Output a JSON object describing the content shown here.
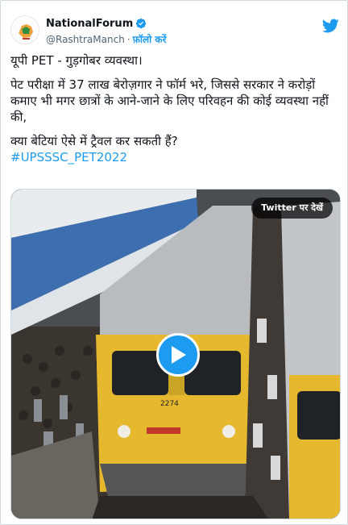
{
  "author": {
    "display_name": "NationalForum",
    "handle": "@RashtraManch",
    "separator": "·",
    "follow_label": "फ़ॉलो करें",
    "verified": true
  },
  "tweet": {
    "line1": "यूपी PET - गुड़गोबर व्यवस्था।",
    "line2": "पेट परीक्षा में 37 लाख बेरोज़गार ने फॉर्म भरे, जिससे सरकार ने करोड़ों कमाए भी मगर छात्रों के आने-जाने के लिए परिवहन की कोई व्यवस्था नहीं की,",
    "line3": "क्या बेटियां ऐसे में ट्रैवल कर सकती हैं?",
    "hashtag": "#UPSSSC_PET2022"
  },
  "media": {
    "watch_label": "Twitter पर देखें",
    "train_number": "2274"
  },
  "colors": {
    "accent": "#1d9bf0",
    "text": "#0f1419",
    "muted": "#536471"
  }
}
